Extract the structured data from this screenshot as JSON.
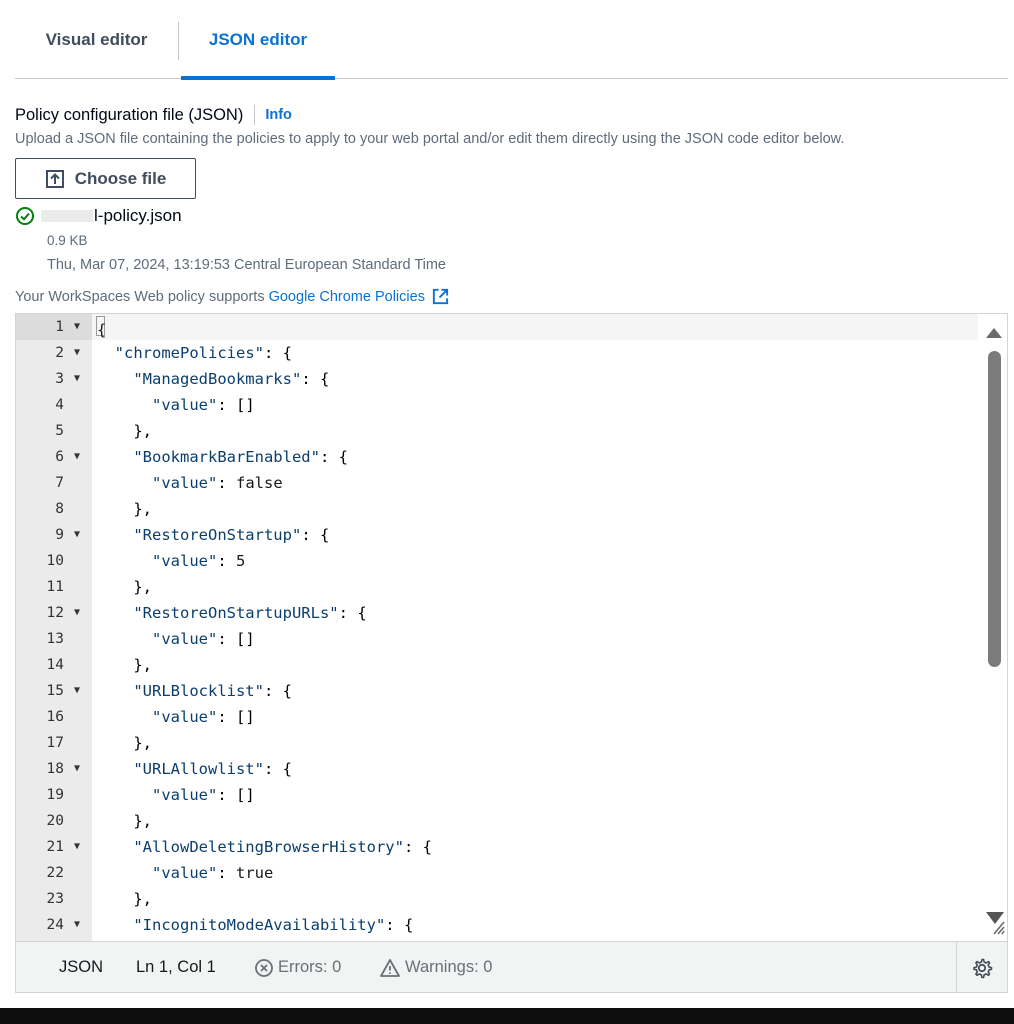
{
  "tabs": [
    {
      "label": "Visual editor",
      "active": false
    },
    {
      "label": "JSON editor",
      "active": true
    }
  ],
  "field": {
    "label": "Policy configuration file (JSON)",
    "info": "Info",
    "description": "Upload a JSON file containing the policies to apply to your web portal and/or edit them directly using the JSON code editor below."
  },
  "upload": {
    "button_label": "Choose file",
    "button_icon": "upload-icon"
  },
  "file": {
    "name_visible": "l-policy.json",
    "status_icon": "check-circle-icon",
    "size": "0.9 KB",
    "date": "Thu, Mar 07, 2024, 13:19:53 Central European Standard Time"
  },
  "supports": {
    "prefix": "Your WorkSpaces Web policy supports",
    "link": "Google Chrome Policies",
    "link_icon": "external-link-icon"
  },
  "editor": {
    "lines": [
      {
        "n": "1",
        "fold": true,
        "text": "{"
      },
      {
        "n": "2",
        "fold": true,
        "text": "  \"chromePolicies\": {"
      },
      {
        "n": "3",
        "fold": true,
        "text": "    \"ManagedBookmarks\": {"
      },
      {
        "n": "4",
        "fold": false,
        "text": "      \"value\": []"
      },
      {
        "n": "5",
        "fold": false,
        "text": "    },"
      },
      {
        "n": "6",
        "fold": true,
        "text": "    \"BookmarkBarEnabled\": {"
      },
      {
        "n": "7",
        "fold": false,
        "text": "      \"value\": false"
      },
      {
        "n": "8",
        "fold": false,
        "text": "    },"
      },
      {
        "n": "9",
        "fold": true,
        "text": "    \"RestoreOnStartup\": {"
      },
      {
        "n": "10",
        "fold": false,
        "text": "      \"value\": 5"
      },
      {
        "n": "11",
        "fold": false,
        "text": "    },"
      },
      {
        "n": "12",
        "fold": true,
        "text": "    \"RestoreOnStartupURLs\": {"
      },
      {
        "n": "13",
        "fold": false,
        "text": "      \"value\": []"
      },
      {
        "n": "14",
        "fold": false,
        "text": "    },"
      },
      {
        "n": "15",
        "fold": true,
        "text": "    \"URLBlocklist\": {"
      },
      {
        "n": "16",
        "fold": false,
        "text": "      \"value\": []"
      },
      {
        "n": "17",
        "fold": false,
        "text": "    },"
      },
      {
        "n": "18",
        "fold": true,
        "text": "    \"URLAllowlist\": {"
      },
      {
        "n": "19",
        "fold": false,
        "text": "      \"value\": []"
      },
      {
        "n": "20",
        "fold": false,
        "text": "    },"
      },
      {
        "n": "21",
        "fold": true,
        "text": "    \"AllowDeletingBrowserHistory\": {"
      },
      {
        "n": "22",
        "fold": false,
        "text": "      \"value\": true"
      },
      {
        "n": "23",
        "fold": false,
        "text": "    },"
      },
      {
        "n": "24",
        "fold": true,
        "text": "    \"IncognitoModeAvailability\": {"
      }
    ]
  },
  "status": {
    "language": "JSON",
    "position": "Ln 1, Col 1",
    "errors": "Errors: 0",
    "warnings": "Warnings: 0",
    "errors_icon": "error-circle-icon",
    "warnings_icon": "warning-triangle-icon",
    "settings_icon": "gear-icon"
  }
}
